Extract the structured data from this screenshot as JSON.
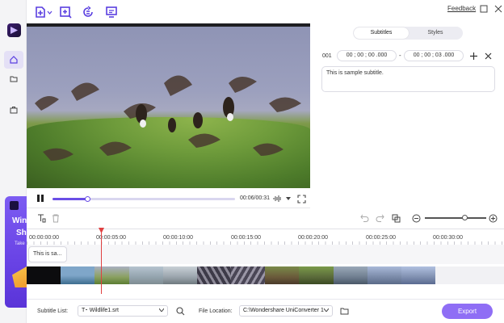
{
  "app": {
    "feedback_label": "Feedback"
  },
  "toolbar_icons": [
    "add-file-icon",
    "add-crop-icon",
    "refresh-subtitle-icon",
    "import-subtitle-icon"
  ],
  "player": {
    "time": "00:06/00:31",
    "progress_fraction": 0.19
  },
  "subtitle_editor": {
    "tabs": [
      {
        "label": "Subtitles",
        "active": true
      },
      {
        "label": "Styles",
        "active": false
      }
    ],
    "entry": {
      "index": "001",
      "start": "00 ; 00 ; 00 .000",
      "end": "00 ; 00 ; 03 .000",
      "text": "This is sample subtitle."
    }
  },
  "promo": {
    "line1": "Win",
    "line2": "Sh",
    "line3": "Take"
  },
  "timeline": {
    "ticks": [
      "00:00:00:00",
      "00:00:05:00",
      "00:00:10:00",
      "00:00:15:00",
      "00:00:20:00",
      "00:00:25:00",
      "00:00:30:00"
    ],
    "subtitle_clip": "This is sa...",
    "zoom_level_fraction": 0.64
  },
  "bottom": {
    "subtitle_list_label": "Subtitle List:",
    "subtitle_file": "Wildlife1.srt",
    "file_location_label": "File Location:",
    "file_location": "C:\\Wondershare UniConverter 1",
    "export_label": "Export"
  },
  "colors": {
    "accent": "#6a4ee6",
    "export_button": "#8f6ef5",
    "playhead": "#e04040"
  }
}
